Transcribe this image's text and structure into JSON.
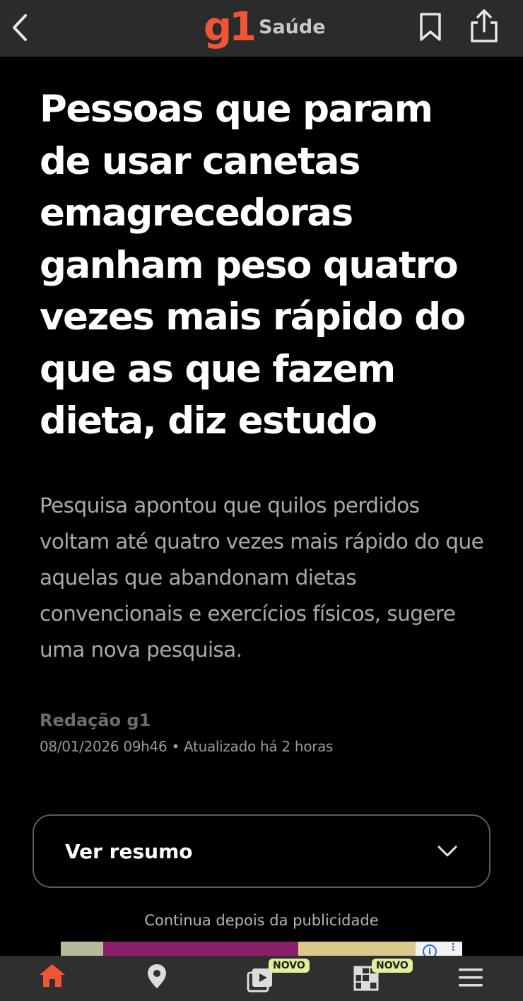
{
  "header": {
    "brand": "g1",
    "section": "Saúde",
    "back_icon": "chevron-left-icon",
    "bookmark_icon": "bookmark-icon",
    "share_icon": "share-icon"
  },
  "article": {
    "headline": "Pessoas que param de usar canetas emagrecedoras ganham peso quatro vezes mais rápido do que as que fazem dieta, diz estudo",
    "subtitle": "Pesquisa apontou que quilos perdidos voltam até quatro vezes mais rápido do que aquelas que abandonam dietas convencionais e exercícios físicos, sugere uma nova pesquisa.",
    "author": "Redação g1",
    "dateline": "08/01/2026 09h46 • Atualizado há 2 horas"
  },
  "summary": {
    "label": "Ver resumo",
    "icon": "chevron-down-icon"
  },
  "ad": {
    "note": "Continua depois da publicidade"
  },
  "bottom_nav": {
    "items": [
      {
        "name": "home",
        "icon": "home-icon",
        "active": true
      },
      {
        "name": "location",
        "icon": "location-pin-icon"
      },
      {
        "name": "videos",
        "icon": "video-icon",
        "badge": "NOVO"
      },
      {
        "name": "games",
        "icon": "grid-game-icon",
        "badge": "NOVO"
      },
      {
        "name": "menu",
        "icon": "menu-icon"
      }
    ]
  },
  "colors": {
    "brand": "#f05535",
    "badge": "#e3ef9a",
    "background": "#000000",
    "topbar": "#2b2b2b"
  }
}
